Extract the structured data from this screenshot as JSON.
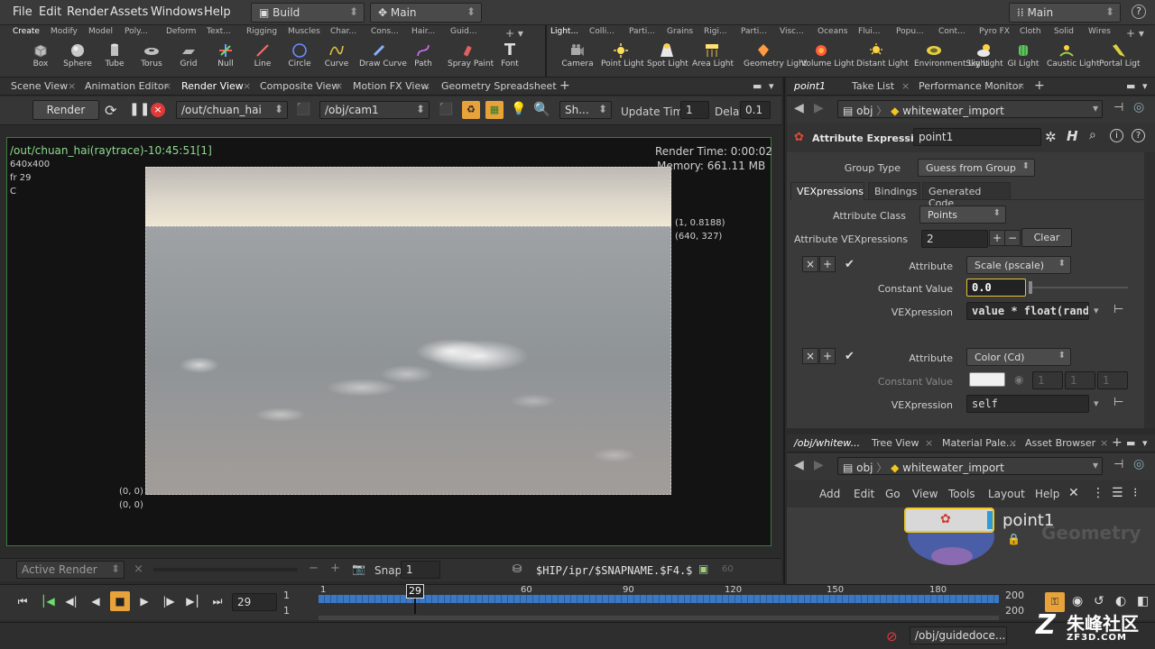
{
  "menubar": {
    "items": [
      "File",
      "Edit",
      "Render",
      "Assets",
      "Windows",
      "Help"
    ],
    "desktop": "Build",
    "context": "Main",
    "right_desktop": "Main"
  },
  "shelf_left": {
    "tabs": [
      "Create",
      "Modify",
      "Model",
      "Poly...",
      "Deform",
      "Text...",
      "Rigging",
      "Muscles",
      "Char...",
      "Cons...",
      "Hair...",
      "Guid..."
    ],
    "tools": [
      "Box",
      "Sphere",
      "Tube",
      "Torus",
      "Grid",
      "Null",
      "Line",
      "Circle",
      "Curve",
      "Draw Curve",
      "Path",
      "Spray Paint",
      "Font"
    ]
  },
  "shelf_right": {
    "tabs": [
      "Light...",
      "Colli...",
      "Parti...",
      "Grains",
      "Rigi...",
      "Parti...",
      "Visc...",
      "Oceans",
      "Flui...",
      "Popu...",
      "Cont...",
      "Pyro FX",
      "Cloth",
      "Solid",
      "Wires"
    ],
    "tools": [
      "Camera",
      "Point Light",
      "Spot Light",
      "Area Light",
      "Geometry Light",
      "Volume Light",
      "Distant Light",
      "Environment Light",
      "Sky Light",
      "GI Light",
      "Caustic Light",
      "Portal Ligt"
    ]
  },
  "left_pane": {
    "tabs": [
      "Scene View",
      "Animation Editor",
      "Render View",
      "Composite View",
      "Motion FX View",
      "Geometry Spreadsheet"
    ],
    "render_button": "Render",
    "rop_path": "/out/chuan_hai",
    "camera_path": "/obj/cam1",
    "shading": "Sh...",
    "update_time_label": "Update Time",
    "update_time_value": "1",
    "delay_label": "Delay",
    "delay_value": "0.1"
  },
  "viewport": {
    "title": "/out/chuan_hai(raytrace)-10:45:51[1]",
    "resolution": "640x400",
    "frame": "fr 29",
    "channel": "C",
    "render_time": "Render Time: 0:00:02",
    "memory": "Memory:  661.11 MB",
    "coord_uv": "(1, 0.8188)",
    "coord_px": "(640, 327)",
    "origin_uv": "(0, 0)",
    "origin_px": "(0, 0)"
  },
  "viewport_footer": {
    "active_render": "Active Render",
    "snap_label": "Snap",
    "snap_value": "1",
    "snapshot_path": "$HIP/ipr/$SNAPNAME.$F4.$",
    "page": "60"
  },
  "param_pane": {
    "tabs": [
      "point1",
      "Take List",
      "Performance Monitor"
    ],
    "path_obj": "obj",
    "path_node": "whitewater_import",
    "node_type": "Attribute Expression",
    "node_name": "point1",
    "group_type_label": "Group Type",
    "group_type_value": "Guess from Group",
    "sub_tabs": [
      "VEXpressions",
      "Bindings",
      "Generated Code"
    ],
    "attribute_class_label": "Attribute Class",
    "attribute_class_value": "Points",
    "attr_vex_label": "Attribute VEXpressions",
    "attr_vex_count": "2",
    "clear_label": "Clear",
    "attribute_label": "Attribute",
    "constant_label": "Constant Value",
    "vexpression_label": "VEXpression",
    "entry1": {
      "attribute": "Scale (pscale)",
      "constant": "0.0",
      "vex": "value * float(rand("
    },
    "entry2": {
      "attribute": "Color (Cd)",
      "constant_parts": [
        "1",
        "1",
        "1"
      ],
      "vex": "self"
    }
  },
  "network_pane": {
    "tabs": [
      "/obj/whitew...",
      "Tree View",
      "Material Pale...",
      "Asset Browser"
    ],
    "path_obj": "obj",
    "path_node": "whitewater_import",
    "menu": [
      "Add",
      "Edit",
      "Go",
      "View",
      "Tools",
      "Layout",
      "Help"
    ],
    "node_name": "point1",
    "context_watermark": "Geometry"
  },
  "timeline": {
    "current_frame": "29",
    "start": "1",
    "start2": "1",
    "ticks": [
      "1",
      "30",
      "60",
      "90",
      "120",
      "150",
      "180"
    ],
    "end": "200",
    "end2": "200",
    "current_marker": "29"
  },
  "statusbar": {
    "path": "/obj/guidedoce...",
    "watermark": "朱峰社区",
    "watermark_url": "ZF3D.COM"
  },
  "colors": {
    "accent_orange": "#e8a23a",
    "viewport_border": "#3c7a3c",
    "timeline_blue": "#3b78c4",
    "node_yellow": "#f2c61f",
    "title_green": "#8fd98f"
  }
}
